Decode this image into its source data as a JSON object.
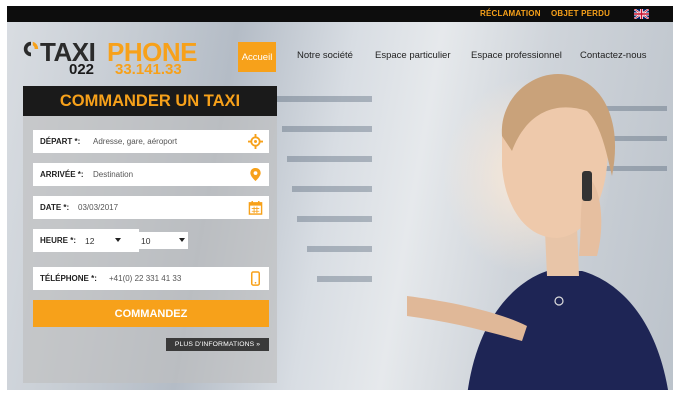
{
  "topbar": {
    "reclamation": "RÉCLAMATION",
    "objet_perdu": "OBJET PERDU",
    "flag_icon": "uk-flag-icon"
  },
  "logo": {
    "taxi": "TAXI",
    "phone": "PHONE",
    "prefix": "022",
    "number": "33.141.33"
  },
  "nav": {
    "items": [
      {
        "label": "Accueil",
        "active": true
      },
      {
        "label": "Notre société"
      },
      {
        "label": "Espace particulier"
      },
      {
        "label": "Espace professionnel"
      },
      {
        "label": "Contactez-nous"
      }
    ]
  },
  "order": {
    "title": "COMMANDER UN TAXI",
    "depart": {
      "label": "DÉPART *:",
      "placeholder": "Adresse, gare, aéroport",
      "icon": "crosshair-icon"
    },
    "arrivee": {
      "label": "ARRIVÉE *:",
      "placeholder": "Destination",
      "icon": "map-pin-icon"
    },
    "date": {
      "label": "DATE *:",
      "value": "03/03/2017",
      "icon": "calendar-icon"
    },
    "heure": {
      "label": "HEURE *:",
      "hour": "12",
      "minute": "10",
      "separator": ":"
    },
    "telephone": {
      "label": "TÉLÉPHONE *:",
      "value": "+41(0) 22 331 41 33",
      "icon": "mobile-phone-icon"
    },
    "submit": "COMMANDEZ",
    "more_info": "PLUS D'INFORMATIONS »"
  },
  "colors": {
    "accent": "#f7a11a",
    "dark": "#1a1a1a"
  }
}
